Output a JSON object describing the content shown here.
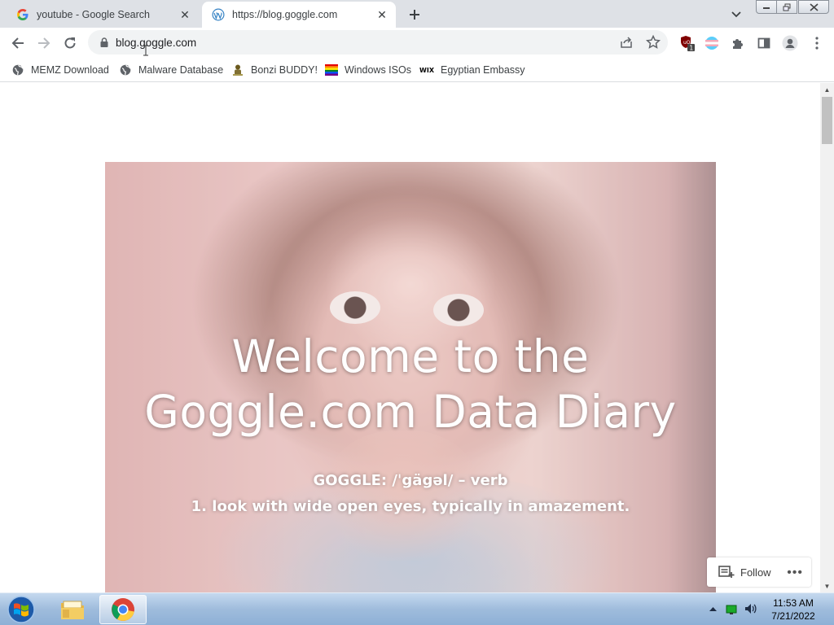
{
  "tabs": [
    {
      "title": "youtube - Google Search",
      "favicon": "google-icon",
      "active": false
    },
    {
      "title": "https://blog.goggle.com",
      "favicon": "wordpress-icon",
      "active": true
    }
  ],
  "address_bar": {
    "url": "blog.goggle.com"
  },
  "bookmarks": [
    {
      "label": "MEMZ Download",
      "icon": "globe-icon"
    },
    {
      "label": "Malware Database",
      "icon": "globe-icon"
    },
    {
      "label": "Bonzi BUDDY!",
      "icon": "bonzi-icon"
    },
    {
      "label": "Windows ISOs",
      "icon": "rainbow-flag-icon"
    },
    {
      "label": "Egyptian Embassy",
      "icon": "wix-icon"
    }
  ],
  "bookmark_wix_text": "WIX",
  "extension_badge": "1",
  "hero": {
    "title_line1": "Welcome to the",
    "title_line2": "Goggle.com Data Diary",
    "def_line1": "GOGGLE: /ˈgägəl/ – verb",
    "def_line2": "1. look with wide open eyes, typically in amazement."
  },
  "follow": {
    "label": "Follow",
    "more": "•••"
  },
  "taskbar": {
    "time": "11:53 AM",
    "date": "7/21/2022"
  },
  "colors": {
    "taskbar": "#9fbcdc",
    "tabstrip": "#dee1e6",
    "omnibox": "#f1f3f4"
  }
}
